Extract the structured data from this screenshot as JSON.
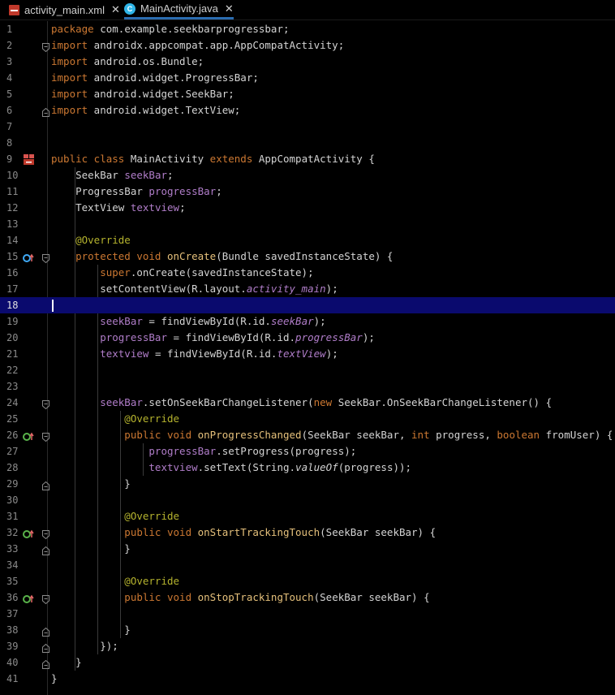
{
  "tabs": [
    {
      "label": "activity_main.xml",
      "icon": "xml-file-icon",
      "close": "✕",
      "active": false
    },
    {
      "label": "MainActivity.java",
      "icon": "java-class-icon",
      "close": "✕",
      "active": true
    }
  ],
  "editor": {
    "current_line": 18,
    "colors": {
      "keyword": "#cc7832",
      "field": "#b07dc9",
      "annotation": "#b5b32e",
      "method": "#e5c07b",
      "current_line_bg": "#0a0a6e"
    },
    "lines": [
      {
        "n": "1",
        "tokens": [
          [
            "kw",
            "package"
          ],
          [
            "p",
            " com.example.seekbarprogressbar;"
          ]
        ]
      },
      {
        "n": "2",
        "tokens": [
          [
            "kw",
            "import"
          ],
          [
            "p",
            " androidx.appcompat.app.AppCompatActivity;"
          ]
        ]
      },
      {
        "n": "3",
        "tokens": [
          [
            "kw",
            "import"
          ],
          [
            "p",
            " android.os.Bundle;"
          ]
        ]
      },
      {
        "n": "4",
        "tokens": [
          [
            "kw",
            "import"
          ],
          [
            "p",
            " android.widget.ProgressBar;"
          ]
        ]
      },
      {
        "n": "5",
        "tokens": [
          [
            "kw",
            "import"
          ],
          [
            "p",
            " android.widget.SeekBar;"
          ]
        ]
      },
      {
        "n": "6",
        "tokens": [
          [
            "kw",
            "import"
          ],
          [
            "p",
            " android.widget.TextView;"
          ]
        ]
      },
      {
        "n": "7",
        "tokens": []
      },
      {
        "n": "8",
        "tokens": []
      },
      {
        "n": "9",
        "tokens": [
          [
            "kw",
            "public class"
          ],
          [
            "p",
            " MainActivity "
          ],
          [
            "kw",
            "extends"
          ],
          [
            "p",
            " AppCompatActivity {"
          ]
        ]
      },
      {
        "n": "10",
        "tokens": [
          [
            "p",
            "    SeekBar "
          ],
          [
            "fld",
            "seekBar"
          ],
          [
            "p",
            ";"
          ]
        ]
      },
      {
        "n": "11",
        "tokens": [
          [
            "p",
            "    ProgressBar "
          ],
          [
            "fld",
            "progressBar"
          ],
          [
            "p",
            ";"
          ]
        ]
      },
      {
        "n": "12",
        "tokens": [
          [
            "p",
            "    TextView "
          ],
          [
            "fld",
            "textview"
          ],
          [
            "p",
            ";"
          ]
        ]
      },
      {
        "n": "13",
        "tokens": []
      },
      {
        "n": "14",
        "tokens": [
          [
            "ann",
            "    @Override"
          ]
        ]
      },
      {
        "n": "15",
        "tokens": [
          [
            "kw",
            "    protected void "
          ],
          [
            "mth",
            "onCreate"
          ],
          [
            "p",
            "(Bundle savedInstanceState) {"
          ]
        ]
      },
      {
        "n": "16",
        "tokens": [
          [
            "kw",
            "        super"
          ],
          [
            "p",
            ".onCreate(savedInstanceState);"
          ]
        ]
      },
      {
        "n": "17",
        "tokens": [
          [
            "p",
            "        setContentView(R.layout."
          ],
          [
            "fldi",
            "activity_main"
          ],
          [
            "p",
            ");"
          ]
        ]
      },
      {
        "n": "18",
        "tokens": []
      },
      {
        "n": "19",
        "tokens": [
          [
            "fld",
            "        seekBar"
          ],
          [
            "p",
            " = findViewById(R.id."
          ],
          [
            "fldi",
            "seekBar"
          ],
          [
            "p",
            ");"
          ]
        ]
      },
      {
        "n": "20",
        "tokens": [
          [
            "fld",
            "        progressBar"
          ],
          [
            "p",
            " = findViewById(R.id."
          ],
          [
            "fldi",
            "progressBar"
          ],
          [
            "p",
            ");"
          ]
        ]
      },
      {
        "n": "21",
        "tokens": [
          [
            "fld",
            "        textview"
          ],
          [
            "p",
            " = findViewById(R.id."
          ],
          [
            "fldi",
            "textView"
          ],
          [
            "p",
            ");"
          ]
        ]
      },
      {
        "n": "22",
        "tokens": []
      },
      {
        "n": "23",
        "tokens": []
      },
      {
        "n": "24",
        "tokens": [
          [
            "fld",
            "        seekBar"
          ],
          [
            "p",
            ".setOnSeekBarChangeListener("
          ],
          [
            "kw",
            "new"
          ],
          [
            "p",
            " SeekBar.OnSeekBarChangeListener() {"
          ]
        ]
      },
      {
        "n": "25",
        "tokens": [
          [
            "ann",
            "            @Override"
          ]
        ]
      },
      {
        "n": "26",
        "tokens": [
          [
            "kw",
            "            public void "
          ],
          [
            "mth",
            "onProgressChanged"
          ],
          [
            "p",
            "(SeekBar seekBar, "
          ],
          [
            "kw",
            "int"
          ],
          [
            "p",
            " progress, "
          ],
          [
            "kw",
            "boolean"
          ],
          [
            "p",
            " fromUser) {"
          ]
        ]
      },
      {
        "n": "27",
        "tokens": [
          [
            "fld",
            "                progressBar"
          ],
          [
            "p",
            ".setProgress(progress);"
          ]
        ]
      },
      {
        "n": "28",
        "tokens": [
          [
            "fld",
            "                textview"
          ],
          [
            "p",
            ".setText(String."
          ],
          [
            "ital",
            "valueOf"
          ],
          [
            "p",
            "(progress));"
          ]
        ]
      },
      {
        "n": "29",
        "tokens": [
          [
            "p",
            "            }"
          ]
        ]
      },
      {
        "n": "30",
        "tokens": []
      },
      {
        "n": "31",
        "tokens": [
          [
            "ann",
            "            @Override"
          ]
        ]
      },
      {
        "n": "32",
        "tokens": [
          [
            "kw",
            "            public void "
          ],
          [
            "mth",
            "onStartTrackingTouch"
          ],
          [
            "p",
            "(SeekBar seekBar) {"
          ]
        ]
      },
      {
        "n": "33",
        "tokens": [
          [
            "p",
            "            }"
          ]
        ]
      },
      {
        "n": "34",
        "tokens": []
      },
      {
        "n": "35",
        "tokens": [
          [
            "ann",
            "            @Override"
          ]
        ]
      },
      {
        "n": "36",
        "tokens": [
          [
            "kw",
            "            public void "
          ],
          [
            "mth",
            "onStopTrackingTouch"
          ],
          [
            "p",
            "(SeekBar seekBar) {"
          ]
        ]
      },
      {
        "n": "37",
        "tokens": []
      },
      {
        "n": "38",
        "tokens": [
          [
            "p",
            "            }"
          ]
        ]
      },
      {
        "n": "39",
        "tokens": [
          [
            "p",
            "        });"
          ]
        ]
      },
      {
        "n": "40",
        "tokens": [
          [
            "p",
            "    }"
          ]
        ]
      },
      {
        "n": "41",
        "tokens": [
          [
            "p",
            "}"
          ]
        ]
      }
    ],
    "gutter_markers": {
      "9": "class-run-icon",
      "15": "override-method-icon",
      "26": "implement-method-icon",
      "32": "implement-method-icon",
      "36": "implement-method-icon"
    },
    "fold_markers": {
      "2": "fold-start",
      "6": "fold-end",
      "15": "fold-start",
      "24": "fold-start",
      "26": "fold-start",
      "29": "fold-end",
      "32": "fold-start",
      "33": "fold-end",
      "36": "fold-start",
      "38": "fold-end",
      "39": "fold-end",
      "40": "fold-end"
    }
  }
}
